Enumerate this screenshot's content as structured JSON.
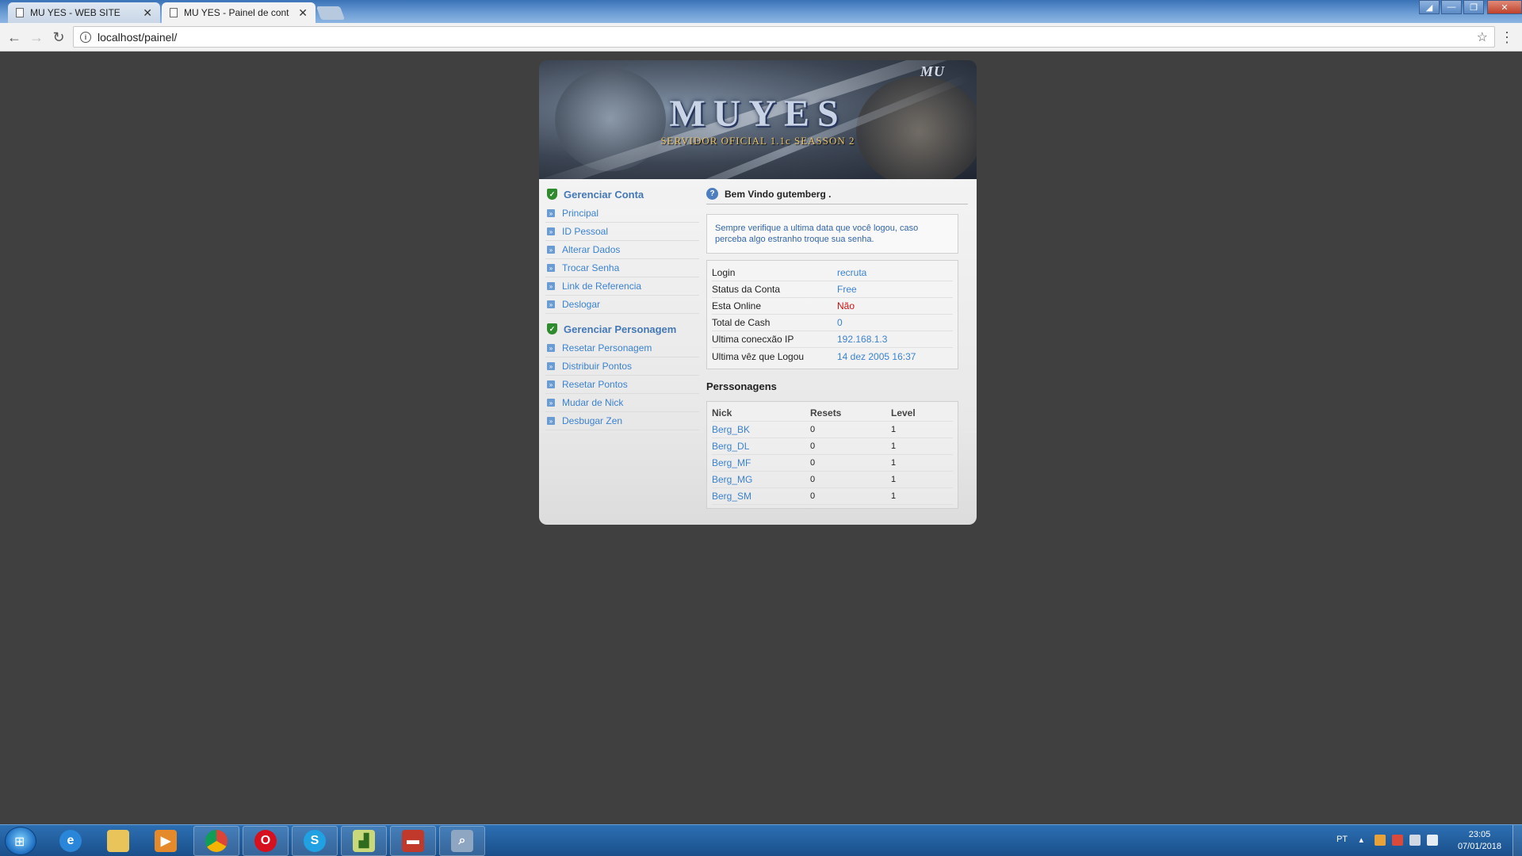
{
  "browser": {
    "tabs": [
      {
        "title": "MU YES - WEB SITE",
        "active": false
      },
      {
        "title": "MU YES - Painel de cont",
        "active": true
      }
    ],
    "url": "localhost/painel/"
  },
  "site": {
    "banner": {
      "logo": "MU",
      "title": "MUYES",
      "subtitle": "SERVIDOR OFICIAL 1.1c SEASSON 2"
    },
    "sidebar": {
      "account_section": "Gerenciar Conta",
      "account_items": [
        "Principal",
        "ID Pessoal",
        "Alterar Dados",
        "Trocar Senha",
        "Link de Referencia",
        "Deslogar"
      ],
      "character_section": "Gerenciar Personagem",
      "character_items": [
        "Resetar Personagem",
        "Distribuir Pontos",
        "Resetar Pontos",
        "Mudar de Nick",
        "Desbugar Zen"
      ]
    },
    "main": {
      "welcome": "Bem Vindo gutemberg .",
      "notice": "Sempre verifique a ultima data que você logou, caso perceba algo estranho troque sua senha.",
      "info": [
        {
          "label": "Login",
          "value": "recruta"
        },
        {
          "label": "Status da Conta",
          "value": "Free"
        },
        {
          "label": "Esta Online",
          "value": "Não"
        },
        {
          "label": "Total de Cash",
          "value": "0"
        },
        {
          "label": "Ultima conecxão IP",
          "value": "192.168.1.3"
        },
        {
          "label": "Ultima vêz que Logou",
          "value": "14 dez 2005 16:37"
        }
      ],
      "characters_title": "Perssonagens",
      "characters_headers": [
        "Nick",
        "Resets",
        "Level"
      ],
      "characters": [
        {
          "nick": "Berg_BK",
          "resets": "0",
          "level": "1"
        },
        {
          "nick": "Berg_DL",
          "resets": "0",
          "level": "1"
        },
        {
          "nick": "Berg_MF",
          "resets": "0",
          "level": "1"
        },
        {
          "nick": "Berg_MG",
          "resets": "0",
          "level": "1"
        },
        {
          "nick": "Berg_SM",
          "resets": "0",
          "level": "1"
        }
      ]
    }
  },
  "taskbar": {
    "language": "PT",
    "time": "23:05",
    "date": "07/01/2018"
  }
}
